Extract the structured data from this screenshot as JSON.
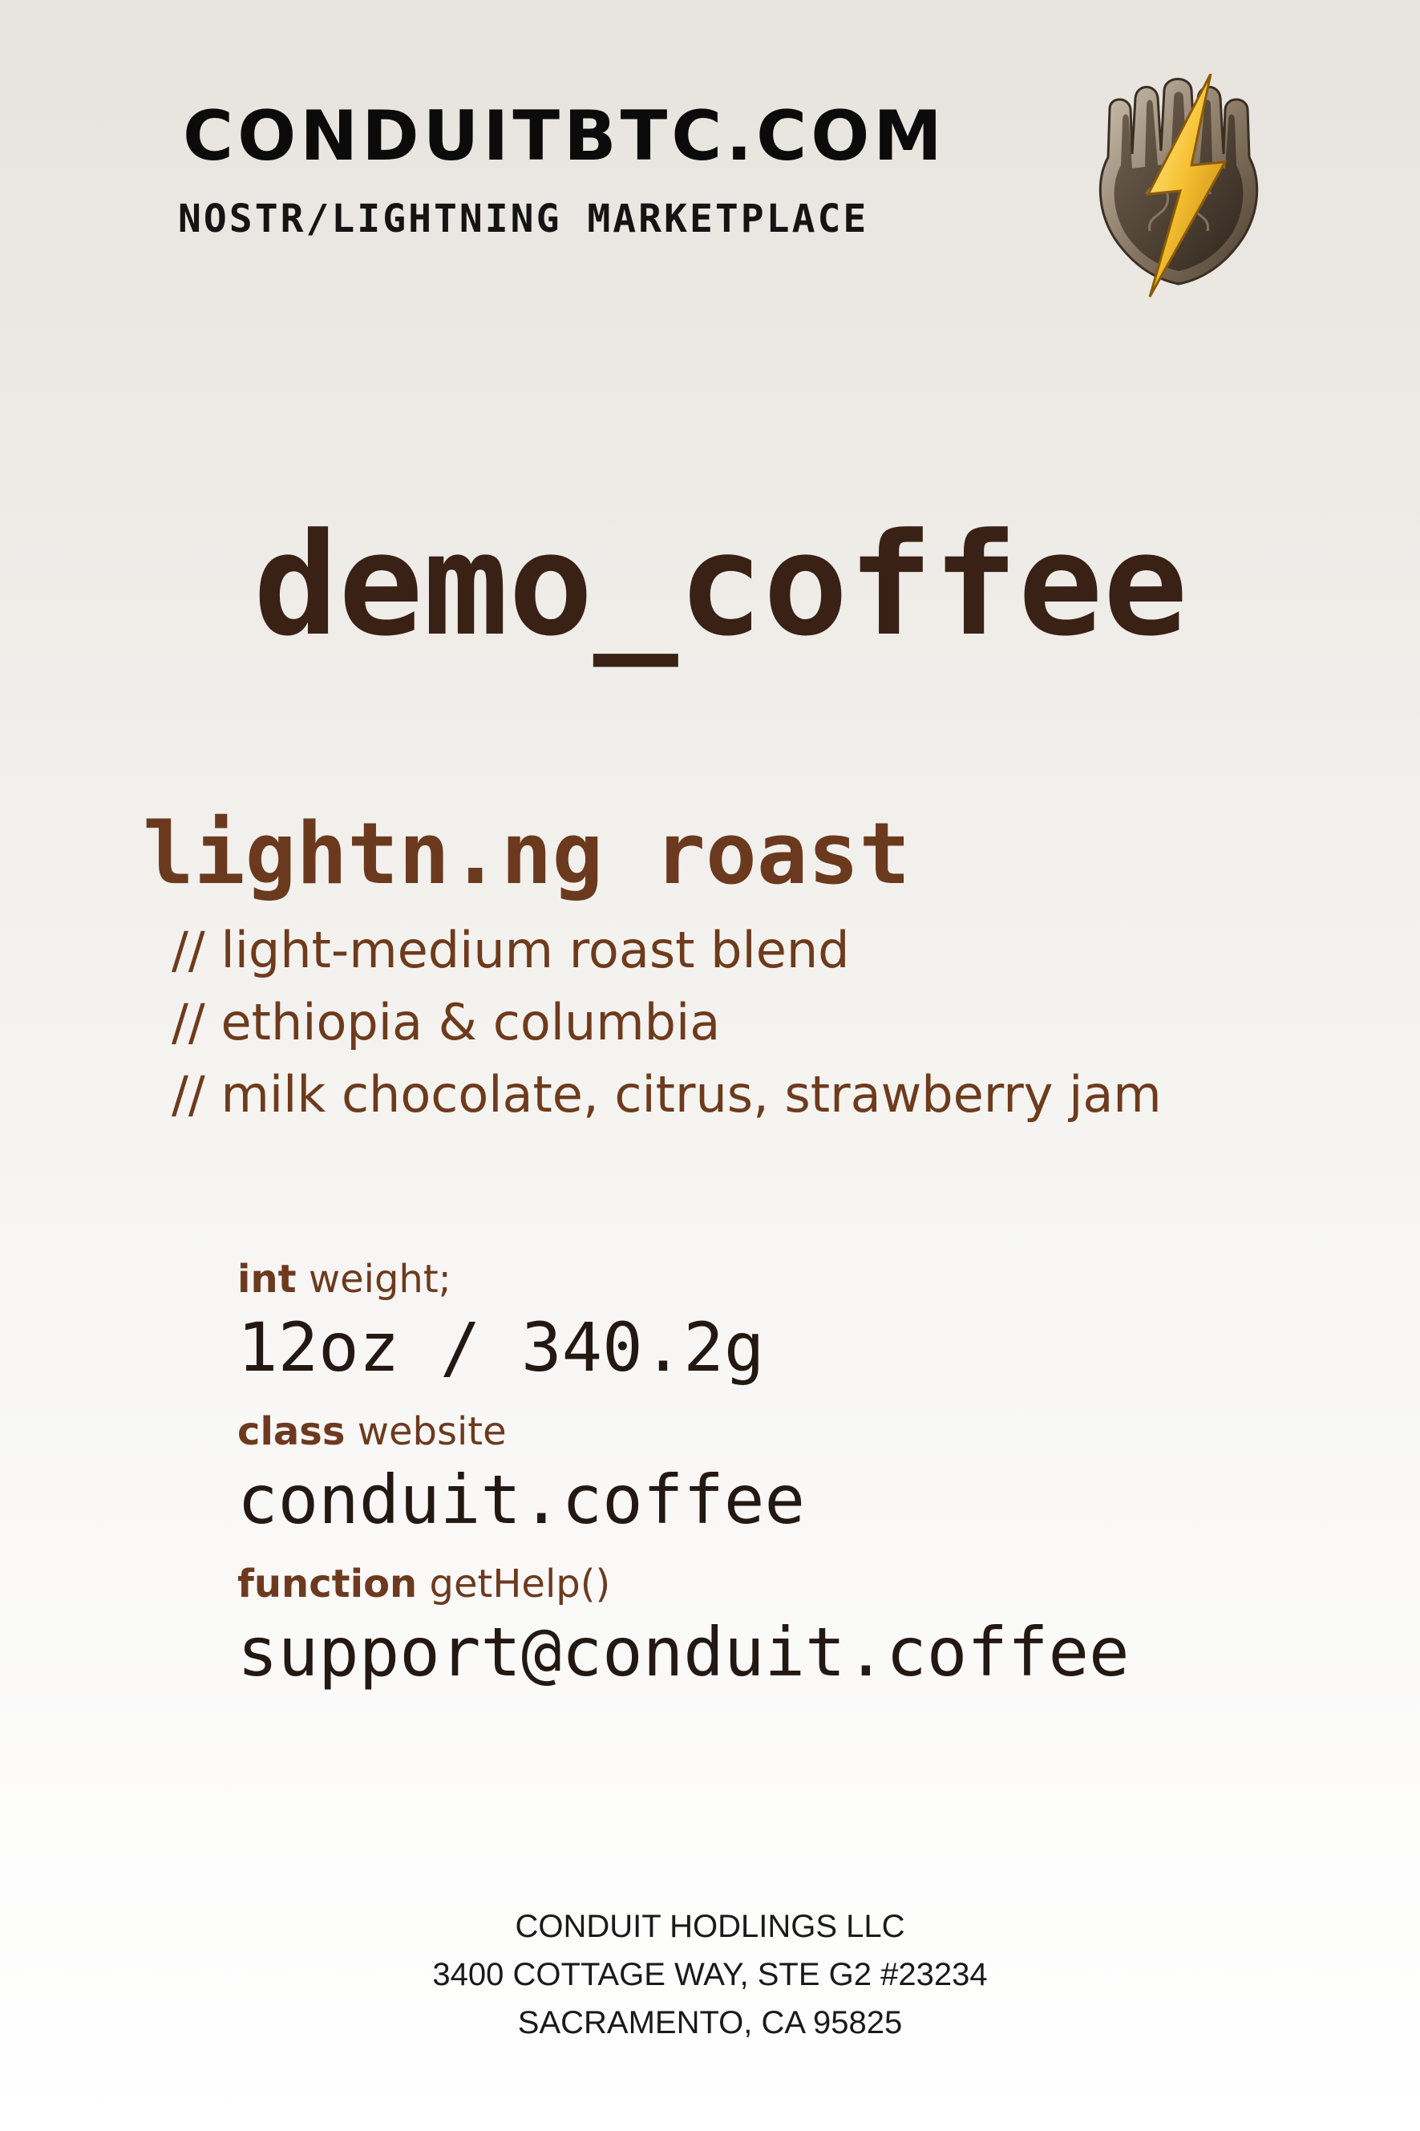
{
  "header": {
    "brand_title": "CONDUITBTC.COM",
    "brand_subtitle": "NOSTR/LIGHTNING MARKETPLACE",
    "logo_icon": "hamsa-lightning-icon"
  },
  "product": {
    "name": "demo_coffee"
  },
  "roast": {
    "title": "lightn.ng roast",
    "notes": [
      "// light-medium roast blend",
      "// ethiopia & columbia",
      "// milk chocolate, citrus, strawberry jam"
    ]
  },
  "specs": {
    "weight": {
      "keyword": "int",
      "label": " weight;",
      "value": "12oz / 340.2g"
    },
    "website": {
      "keyword": "class",
      "label": " website",
      "value": "conduit.coffee"
    },
    "help": {
      "keyword": "function",
      "label": " getHelp()",
      "value": "support@conduit.coffee"
    }
  },
  "footer": {
    "lines": [
      "CONDUIT HODLINGS LLC",
      "3400 COTTAGE WAY, STE G2 #23234",
      "SACRAMENTO, CA 95825"
    ]
  },
  "colors": {
    "brand_text": "#0b0b0b",
    "product_name": "#3a2115",
    "roast_accent": "#6b3a1e",
    "spec_value": "#241812",
    "logo_gold": "#f2b21c",
    "logo_bronze": "#5a4a3a"
  }
}
